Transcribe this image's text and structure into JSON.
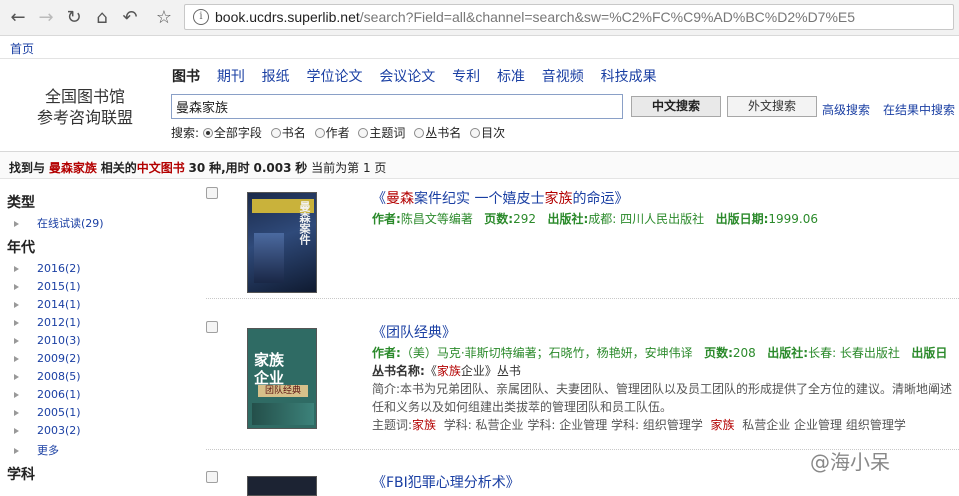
{
  "browser": {
    "url_host": "book.ucdrs.superlib.net",
    "url_path": "/search?Field=all&channel=search&sw=%C2%FC%C9%AD%BC%D2%D7%E5",
    "bookmark_home": "首页"
  },
  "site": {
    "logo_line1": "全国图书馆",
    "logo_line2": "参考咨询联盟",
    "tabs": [
      "图书",
      "期刊",
      "报纸",
      "学位论文",
      "会议论文",
      "专利",
      "标准",
      "音视频",
      "科技成果"
    ],
    "search_value": "曼森家族",
    "btn_chinese": "中文搜索",
    "btn_foreign": "外文搜索",
    "advanced": "高级搜索",
    "in_results": "在结果中搜索",
    "field_label": "搜索:",
    "fields": [
      "全部字段",
      "书名",
      "作者",
      "主题词",
      "丛书名",
      "目次"
    ]
  },
  "summary": {
    "p1": "找到与",
    "keyword": "曼森家族",
    "p2": "相关的",
    "category": "中文图书",
    "count": "30",
    "p3": "种,用时",
    "time": "0.003",
    "p4": "秒",
    "p5": "当前为第",
    "page": "1",
    "p6": "页"
  },
  "facets": {
    "type_heading": "类型",
    "type_items": [
      "在线试读(29)"
    ],
    "year_heading": "年代",
    "year_items": [
      "2016(2)",
      "2015(1)",
      "2014(1)",
      "2012(1)",
      "2010(3)",
      "2009(2)",
      "2008(5)",
      "2006(1)",
      "2005(1)",
      "2003(2)",
      "更多"
    ],
    "subject_heading": "学科"
  },
  "results": [
    {
      "title_pre": "《",
      "title_hl": "曼森",
      "title_mid": "案件纪实  一个嬉皮士",
      "title_hl2": "家族",
      "title_post": "的命运》",
      "author_label": "作者:",
      "author": "陈昌文等编著",
      "pages_label": "页数:",
      "pages": "292",
      "publisher_label": "出版社:",
      "publisher": "成都: 四川人民出版社",
      "date_label": "出版日期:",
      "date": "1999.06",
      "cover_text": "曼森案件"
    },
    {
      "title": "《团队经典》",
      "author_label": "作者:",
      "author": "（美）马克·菲斯切特编著；石晓竹，杨艳妍，安坤伟译",
      "pages_label": "页数:",
      "pages": "208",
      "publisher_label": "出版社:",
      "publisher": "长春: 长春出版社",
      "date_label": "出版日",
      "series_label": "丛书名称:",
      "series_pre": "《",
      "series_hl": "家族",
      "series_post": "企业》丛书",
      "abstract_label": "简介:",
      "abstract_line1": "本书为兄弟团队、亲属团队、夫妻团队、管理团队以及员工团队的形成提供了全方位的建议。清晰地阐述",
      "abstract_line2": "任和义务以及如何组建出类拔萃的管理团队和员工队伍。",
      "subject_label": "主题词:",
      "subject_hl": "家族",
      "subject_rest1": "学科:  私营企业  学科:  企业管理  学科:  组织管理学",
      "subject_hl2": "家族",
      "subject_rest2": "私营企业  企业管理  组织管理学",
      "cover_text1": "家族",
      "cover_text2": "企业",
      "cover_text3": "团队经典"
    },
    {
      "title": "《FBI犯罪心理分析术》"
    }
  ],
  "watermark": "@海小呆",
  "colors": {
    "link": "#1a3fa3",
    "highlight": "#b30000",
    "meta": "#2b8a2b"
  }
}
